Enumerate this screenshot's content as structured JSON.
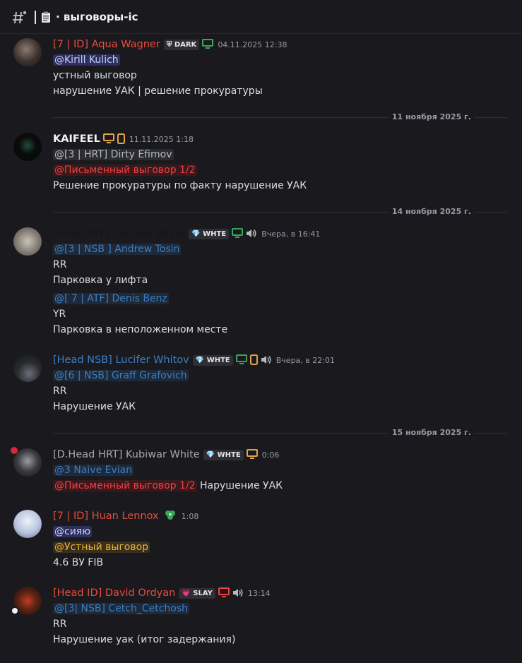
{
  "channel": {
    "title": "выговоры-ic"
  },
  "colors": {
    "red_name": "#e74c3c",
    "blue_name": "#3b7fc4",
    "grey_name": "#a4a6ab",
    "green_dev": "#3ba55d",
    "orange_dev": "#e0a44a"
  },
  "messages": [
    {
      "author": "[7 | ID] Aqua Wagner",
      "tag": "DARK",
      "time": "04.11.2025 12:38",
      "lines": [
        "@Kirill Kulich",
        "устный выговор",
        "нарушение УАК | решение прокуратуры"
      ]
    },
    {
      "author": "KAIFEEL",
      "time": "11.11.2025 1:18",
      "lines": [
        "@[3 | HRT] Dirty Efimov",
        "@Письменный выговор 1/2",
        "Решение прокуратуры по факту нарушение УАК"
      ]
    },
    {
      "author": "[Head ATF] Lacoste White",
      "tag": "WHTE",
      "time": "Вчера, в 16:41",
      "lines": [
        "@[3 | NSB ] Andrew Tosin",
        "RR",
        "Парковка у лифта",
        "@[ 7 | ATF] Denis Benz",
        "YR",
        "Парковка в неположенном месте"
      ]
    },
    {
      "author": "[Head NSB] Lucifer Whitov",
      "tag": "WHTE",
      "time": "Вчера, в 22:01",
      "lines": [
        "@[6 | NSB] Graff Grafovich",
        "RR",
        "Нарушение УАК"
      ]
    },
    {
      "author": "[D.Head HRT] Kubiwar White",
      "tag": "WHTE",
      "time": "0:06",
      "lines": [
        "@3 Naive Evian",
        "@Письменный выговор 1/2",
        "Нарушение УАК"
      ]
    },
    {
      "author": "[7 | ID] Huan Lennox",
      "time": "1:08",
      "lines": [
        "@сияю",
        "@Устный выговор",
        "4.6 ВУ FIB"
      ]
    },
    {
      "author": "[Head ID] David Ordyan",
      "tag": "SLAY",
      "time": "13:14",
      "lines": [
        "@[3| NSB] Cetch_Cetchosh",
        "RR",
        "Нарушение уак (итог задержания)"
      ]
    }
  ],
  "dividers": [
    "11 ноября 2025 г.",
    "14 ноября 2025 г.",
    "15 ноября 2025 г."
  ]
}
